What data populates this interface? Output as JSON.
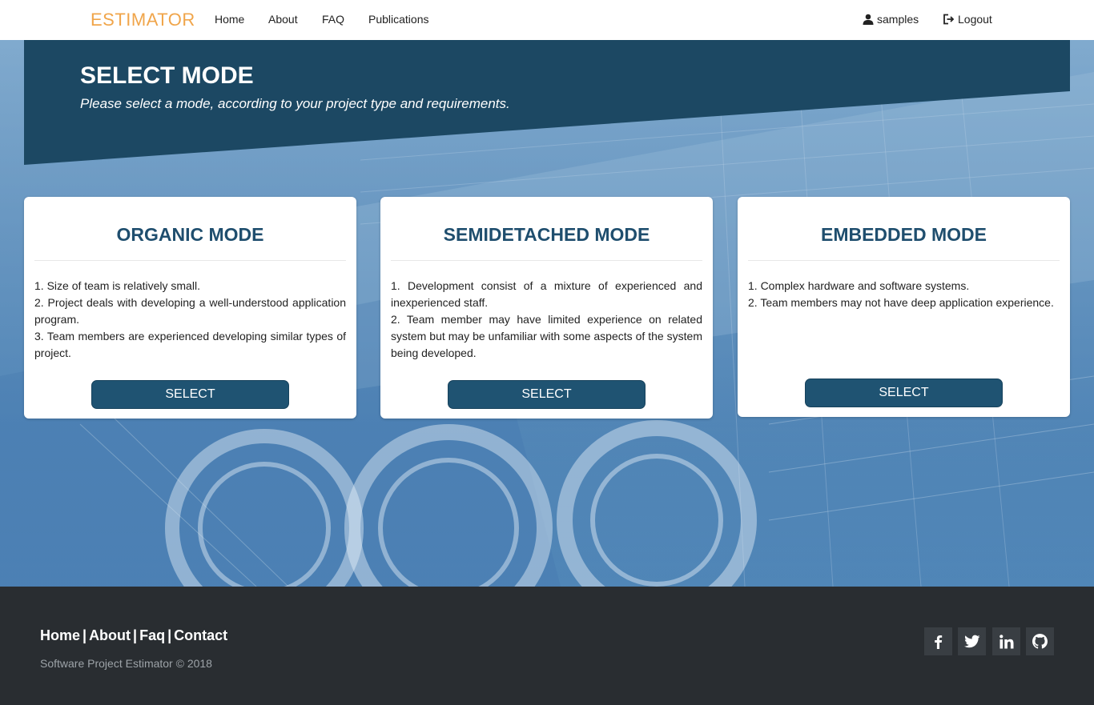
{
  "navbar": {
    "brand": "ESTIMATOR",
    "links": [
      "Home",
      "About",
      "FAQ",
      "Publications"
    ],
    "user_label": "samples",
    "user_icon": "user-icon",
    "logout_label": "Logout",
    "logout_icon": "logout-icon"
  },
  "banner": {
    "title": "SELECT MODE",
    "subtitle": "Please select a mode, according to your project type and requirements."
  },
  "cards": [
    {
      "title": "ORGANIC MODE",
      "lines": [
        "1. Size of team is relatively small.",
        "2. Project deals with developing a well-understood application program.",
        "3. Team members are experienced developing similar types of project."
      ],
      "button": "SELECT"
    },
    {
      "title": "SEMIDETACHED MODE",
      "lines": [
        "1. Development consist of a mixture of experienced and inexperienced staff.",
        "2. Team member may have limited experience on related system but may be unfamiliar with some aspects of the system being developed."
      ],
      "button": "SELECT"
    },
    {
      "title": "EMBEDDED MODE",
      "lines": [
        "1. Complex hardware and software systems.",
        "2. Team members may not have deep application experience."
      ],
      "button": "SELECT"
    }
  ],
  "footer": {
    "links": [
      "Home",
      "About",
      "Faq",
      "Contact"
    ],
    "separator": "|",
    "copyright": "Software Project Estimator © 2018",
    "social": [
      "facebook-icon",
      "twitter-icon",
      "linkedin-icon",
      "github-icon"
    ]
  },
  "colors": {
    "brand": "#f0a54a",
    "banner": "#1c4863",
    "button": "#1f5372",
    "card_title": "#1f4e6e",
    "footer": "#292d31"
  }
}
